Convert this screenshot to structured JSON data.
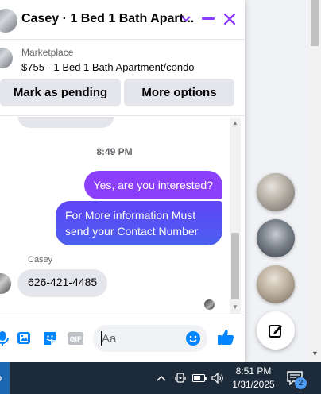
{
  "chat": {
    "title": "Casey · 1 Bed 1 Bath Apart...",
    "marketplace_label": "Marketplace",
    "listing_title": "$755 - 1 Bed 1 Bath Apartment/condo",
    "buttons": {
      "pending": "Mark as pending",
      "more": "More options"
    },
    "timestamp": "8:49 PM",
    "messages_out": [
      "Yes, are you interested?",
      "For More information Must send your Contact Number"
    ],
    "sender_name": "Casey",
    "message_in": "626-421-4485",
    "input_placeholder": "Aa"
  },
  "colors": {
    "accent": "#8b3ffb",
    "outgoing_gradient_start": "#5f45f6",
    "like_blue": "#0084ff"
  },
  "taskbar": {
    "time": "8:51 PM",
    "date": "1/31/2025",
    "notification_count": "2"
  }
}
